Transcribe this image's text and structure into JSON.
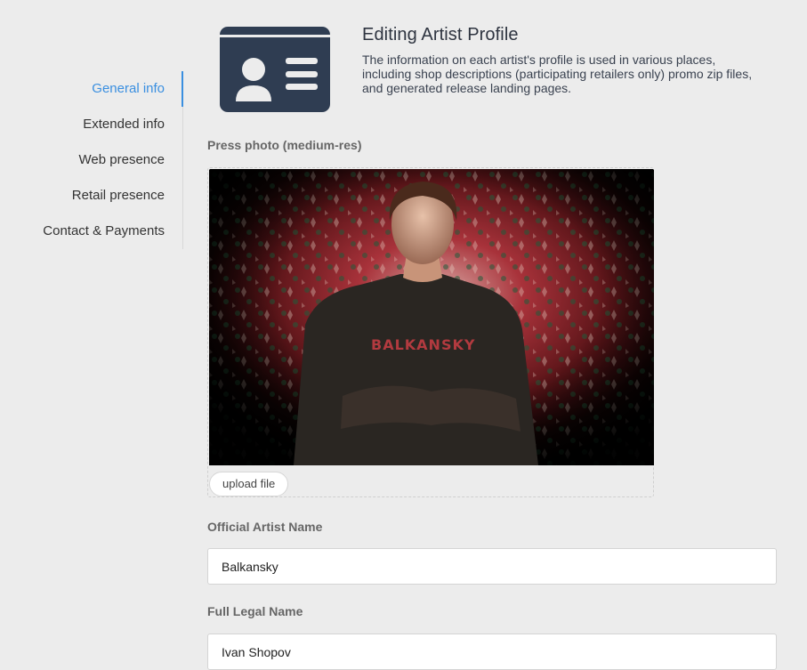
{
  "sidebar": {
    "items": [
      {
        "label": "General info",
        "active": true
      },
      {
        "label": "Extended info"
      },
      {
        "label": "Web presence"
      },
      {
        "label": "Retail presence"
      },
      {
        "label": "Contact & Payments"
      }
    ]
  },
  "header": {
    "icon": "id-card-icon",
    "title": "Editing Artist Profile",
    "description": "The information on each artist's profile is used in various places, including shop descriptions (participating retailers only) promo zip files, and generated release landing pages."
  },
  "press_photo": {
    "label": "Press photo (medium-res)",
    "shirt_text": "BALKANSKY",
    "upload_label": "upload file"
  },
  "fields": {
    "artist_name": {
      "label": "Official Artist Name",
      "value": "Balkansky"
    },
    "legal_name": {
      "label": "Full Legal Name",
      "value": "Ivan Shopov"
    }
  },
  "colors": {
    "accent": "#3a8fe0",
    "icon": "#2f3d52",
    "background": "#ececec"
  }
}
